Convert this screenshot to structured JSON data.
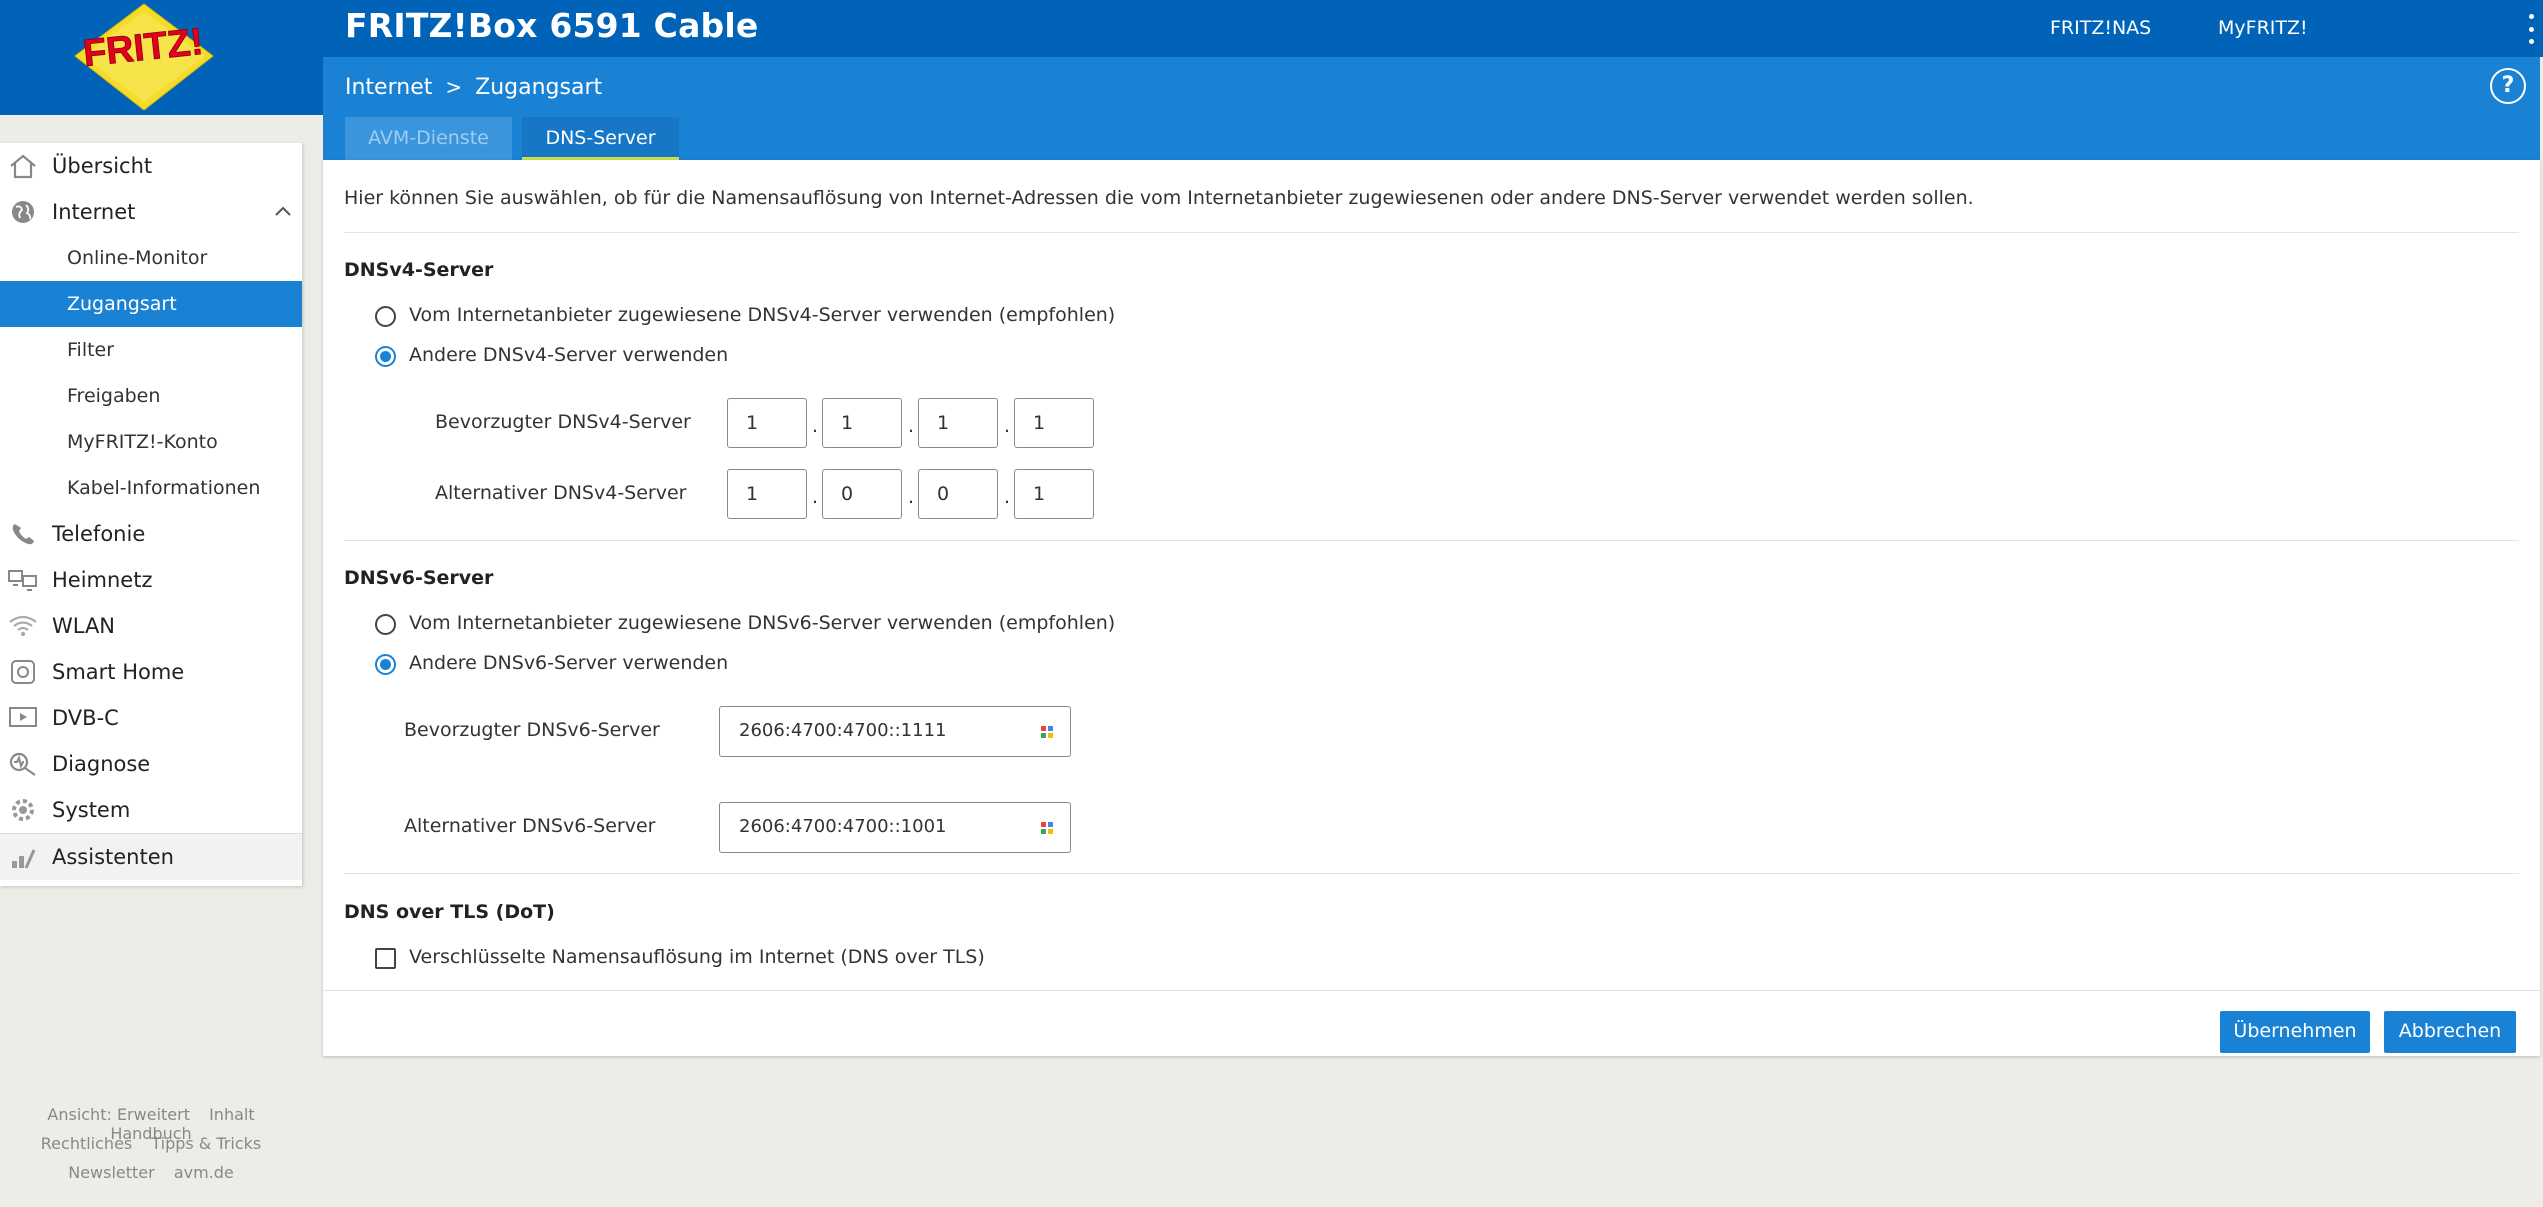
{
  "app": {
    "title": "FRITZ!Box 6591 Cable",
    "logo_text": "FRITZ!",
    "top_links": [
      "FRITZ!NAS",
      "MyFRITZ!"
    ]
  },
  "breadcrumb": {
    "parent": "Internet",
    "separator": ">",
    "current": "Zugangsart"
  },
  "tabs": [
    {
      "label": "AVM-Dienste",
      "active": false
    },
    {
      "label": "DNS-Server",
      "active": true
    }
  ],
  "help_label": "?",
  "sidebar": {
    "items": [
      {
        "label": "Übersicht",
        "icon": "home-icon"
      },
      {
        "label": "Internet",
        "icon": "globe-icon",
        "expanded": true
      },
      {
        "label": "Telefonie",
        "icon": "phone-icon"
      },
      {
        "label": "Heimnetz",
        "icon": "network-icon"
      },
      {
        "label": "WLAN",
        "icon": "wifi-icon"
      },
      {
        "label": "Smart Home",
        "icon": "smart-home-icon"
      },
      {
        "label": "DVB-C",
        "icon": "tv-icon"
      },
      {
        "label": "Diagnose",
        "icon": "diagnose-icon"
      },
      {
        "label": "System",
        "icon": "gear-icon"
      },
      {
        "label": "Assistenten",
        "icon": "wizard-icon"
      }
    ],
    "internet_sub": [
      {
        "label": "Online-Monitor"
      },
      {
        "label": "Zugangsart",
        "active": true
      },
      {
        "label": "Filter"
      },
      {
        "label": "Freigaben"
      },
      {
        "label": "MyFRITZ!-Konto"
      },
      {
        "label": "Kabel-Informationen"
      }
    ]
  },
  "footer": {
    "row1": [
      "Ansicht: Erweitert",
      "Inhalt",
      "Handbuch"
    ],
    "row2": [
      "Rechtliches",
      "Tipps & Tricks"
    ],
    "row3": [
      "Newsletter",
      "avm.de"
    ]
  },
  "main": {
    "intro": "Hier können Sie auswählen, ob für die Namensauflösung von Internet-Adressen die vom Internetanbieter zugewiesenen oder andere DNS-Server verwendet werden sollen.",
    "dnsv4": {
      "heading": "DNSv4-Server",
      "option_isp": "Vom Internetanbieter zugewiesene DNSv4-Server verwenden (empfohlen)",
      "option_other": "Andere DNSv4-Server verwenden",
      "selected": "other",
      "preferred_label": "Bevorzugter DNSv4-Server",
      "preferred": [
        "1",
        "1",
        "1",
        "1"
      ],
      "alternative_label": "Alternativer DNSv4-Server",
      "alternative": [
        "1",
        "0",
        "0",
        "1"
      ],
      "separator": "."
    },
    "dnsv6": {
      "heading": "DNSv6-Server",
      "option_isp": "Vom Internetanbieter zugewiesene DNSv6-Server verwenden (empfohlen)",
      "option_other": "Andere DNSv6-Server verwenden",
      "selected": "other",
      "preferred_label": "Bevorzugter DNSv6-Server",
      "preferred": "2606:4700:4700::1111",
      "alternative_label": "Alternativer DNSv6-Server",
      "alternative": "2606:4700:4700::1001"
    },
    "dot": {
      "heading": "DNS over TLS (DoT)",
      "checkbox_label": "Verschlüsselte Namensauflösung im Internet (DNS over TLS)",
      "checked": false
    },
    "buttons": {
      "apply": "Übernehmen",
      "cancel": "Abbrechen"
    }
  },
  "colors": {
    "topbar": "#0063b7",
    "header": "#1a82d4",
    "accent": "#1a82d4",
    "tab_underline": "#c7e24a",
    "background": "#eeece6"
  }
}
